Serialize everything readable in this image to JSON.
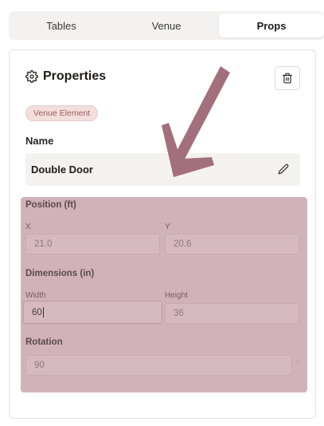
{
  "tabs": [
    {
      "label": "Tables",
      "active": false
    },
    {
      "label": "Venue",
      "active": false
    },
    {
      "label": "Props",
      "active": true
    }
  ],
  "panel": {
    "title": "Properties",
    "title_icon": "gear-icon",
    "delete_icon": "trash-icon",
    "badge": "Venue Element"
  },
  "name": {
    "label": "Name",
    "value": "Double Door",
    "edit_icon": "pencil-icon"
  },
  "position": {
    "title": "Position (ft)",
    "x_label": "X",
    "x_value": "21.0",
    "y_label": "Y",
    "y_value": "20.6"
  },
  "dimensions": {
    "title": "Dimensions (in)",
    "width_label": "Width",
    "width_value": "60",
    "height_label": "Height",
    "height_value": "36"
  },
  "rotation": {
    "title": "Rotation",
    "value": "90",
    "suffix": "°"
  },
  "colors": {
    "highlight_overlay": "#d2b2b9",
    "arrow": "#a36f7c",
    "badge_bg": "#f3dede"
  }
}
